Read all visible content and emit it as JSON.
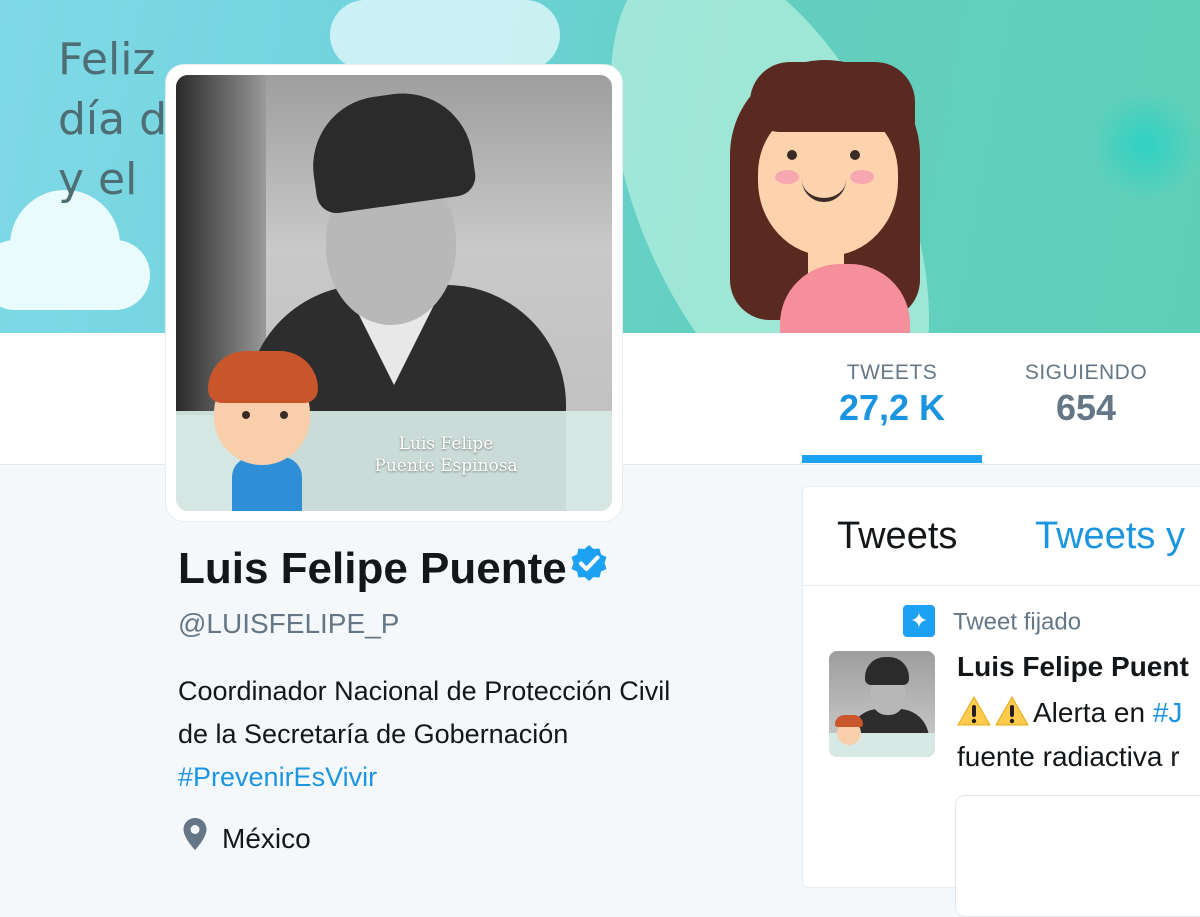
{
  "banner": {
    "greeting_lines": [
      "Feliz",
      "día d",
      "y el"
    ]
  },
  "profile": {
    "avatar_caption_line1": "Luis Felipe",
    "avatar_caption_line2": "Puente Espinosa",
    "name": "Luis Felipe Puente",
    "handle": "@LUISFELIPE_P",
    "bio_line1": "Coordinador Nacional de Protección Civil",
    "bio_line2": "de la Secretaría de Gobernación",
    "bio_hashtag": "#PrevenirEsVivir",
    "location": "México"
  },
  "stats": [
    {
      "label": "TWEETS",
      "value": "27,2 K"
    },
    {
      "label": "SIGUIENDO",
      "value": "654"
    }
  ],
  "timeline": {
    "tabs": [
      "Tweets",
      "Tweets y"
    ],
    "pinned_label": "Tweet fijado",
    "tweet": {
      "author": "Luis Felipe Puent",
      "line1_text": "Alerta en ",
      "line1_tag": "#J",
      "line2": "fuente radiactiva r"
    }
  },
  "colors": {
    "accent": "#1da1f2",
    "link": "#1b95e0",
    "text": "#14171a",
    "muted": "#657786",
    "banner": "#6fd3dc"
  },
  "icons": {
    "verified": "verified-badge-icon",
    "location": "location-pin-icon",
    "pinned": "pin-icon",
    "warning": "warning-icon"
  }
}
